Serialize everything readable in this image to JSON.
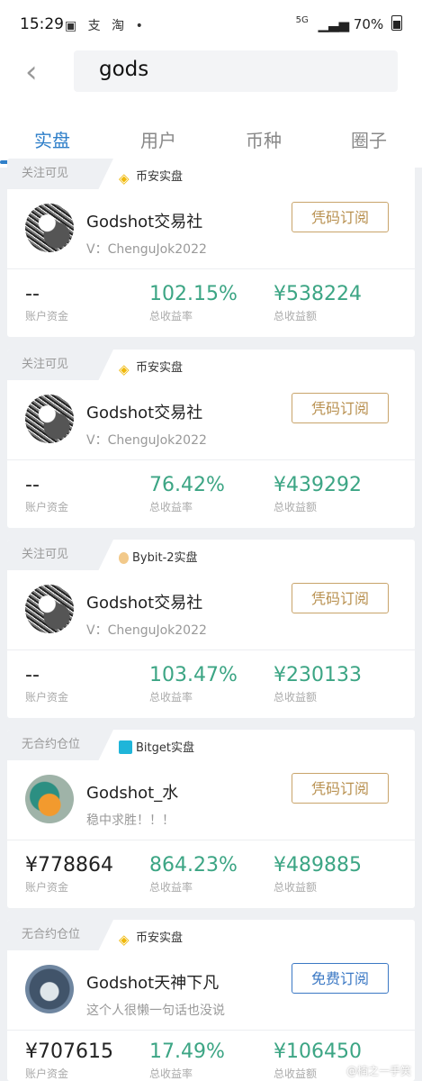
{
  "status_bar": {
    "time": "15:29",
    "left_icons": "▣ 支 淘 •",
    "network": "5G",
    "battery": "70%"
  },
  "search": {
    "query": "gods"
  },
  "tabs": [
    {
      "label": "实盘",
      "active": true
    },
    {
      "label": "用户",
      "active": false
    },
    {
      "label": "币种",
      "active": false
    },
    {
      "label": "圈子",
      "active": false
    }
  ],
  "cards": [
    {
      "visibility": "关注可见",
      "exchange": "币安实盘",
      "exchange_icon": "binance-icon",
      "name": "Godshot交易社",
      "subtitle": "V：ChenguJok2022",
      "button": "凭码订阅",
      "stats": [
        {
          "value": "--",
          "label": "账户资金"
        },
        {
          "value": "102.15%",
          "label": "总收益率"
        },
        {
          "value": "¥538224",
          "label": "总收益额"
        }
      ]
    },
    {
      "visibility": "关注可见",
      "exchange": "币安实盘",
      "exchange_icon": "binance-icon",
      "name": "Godshot交易社",
      "subtitle": "V：ChenguJok2022",
      "button": "凭码订阅",
      "stats": [
        {
          "value": "--",
          "label": "账户资金"
        },
        {
          "value": "76.42%",
          "label": "总收益率"
        },
        {
          "value": "¥439292",
          "label": "总收益额"
        }
      ]
    },
    {
      "visibility": "关注可见",
      "exchange": "Bybit-2实盘",
      "exchange_icon": "bybit-icon",
      "name": "Godshot交易社",
      "subtitle": "V：ChenguJok2022",
      "button": "凭码订阅",
      "stats": [
        {
          "value": "--",
          "label": "账户资金"
        },
        {
          "value": "103.47%",
          "label": "总收益率"
        },
        {
          "value": "¥230133",
          "label": "总收益额"
        }
      ]
    },
    {
      "visibility": "无合约仓位",
      "exchange": "Bitget实盘",
      "exchange_icon": "bitget-icon",
      "name": "Godshot_水",
      "subtitle": "稳中求胜！！！",
      "button": "凭码订阅",
      "stats": [
        {
          "value": "¥778864",
          "label": "账户资金"
        },
        {
          "value": "864.23%",
          "label": "总收益率"
        },
        {
          "value": "¥489885",
          "label": "总收益额"
        }
      ]
    },
    {
      "visibility": "无合约仓位",
      "exchange": "币安实盘",
      "exchange_icon": "binance-icon",
      "name": "Godshot天神下凡",
      "subtitle": "这个人很懒一句话也没说",
      "button": "免费订阅",
      "stats": [
        {
          "value": "¥707615",
          "label": "账户资金"
        },
        {
          "value": "17.49%",
          "label": "总收益率"
        },
        {
          "value": "¥106450",
          "label": "总收益额"
        }
      ]
    }
  ],
  "watermark": "@楠之一手笑",
  "colors": {
    "accent": "#2f7fc9",
    "gain": "#3ca584",
    "gold": "#c8a46a"
  }
}
